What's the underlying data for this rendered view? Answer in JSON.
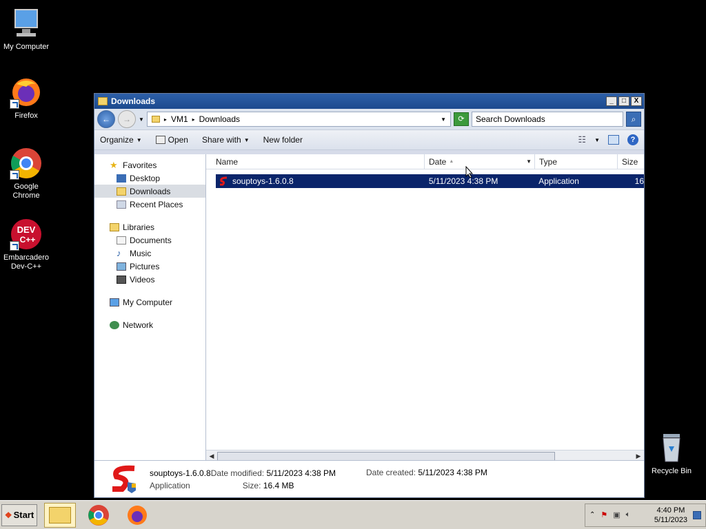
{
  "desktop": {
    "icons": [
      {
        "label": "My Computer"
      },
      {
        "label": "Firefox"
      },
      {
        "label": "Google Chrome"
      },
      {
        "label": "Embarcadero Dev-C++"
      },
      {
        "label": "Recycle Bin"
      }
    ]
  },
  "window": {
    "title": "Downloads",
    "buttons": {
      "minimize": "_",
      "maximize": "□",
      "close": "X"
    }
  },
  "addressbar": {
    "crumbs": [
      "VM1",
      "Downloads"
    ],
    "search_placeholder": "Search Downloads"
  },
  "toolbar": {
    "organize": "Organize",
    "open": "Open",
    "share_with": "Share with",
    "new_folder": "New folder"
  },
  "navpane": {
    "favorites": {
      "label": "Favorites",
      "items": [
        "Desktop",
        "Downloads",
        "Recent Places"
      ]
    },
    "libraries": {
      "label": "Libraries",
      "items": [
        "Documents",
        "Music",
        "Pictures",
        "Videos"
      ]
    },
    "computer": "My Computer",
    "network": "Network"
  },
  "columns": [
    "Name",
    "Date",
    "Type",
    "Size"
  ],
  "files": [
    {
      "name": "souptoys-1.6.0.8",
      "date": "5/11/2023 4:38 PM",
      "type": "Application",
      "size": "16"
    }
  ],
  "details": {
    "name": "souptoys-1.6.0.8",
    "type": "Application",
    "date_modified_label": "Date modified:",
    "date_modified": "5/11/2023 4:38 PM",
    "size_label": "Size:",
    "size": "16.4 MB",
    "date_created_label": "Date created:",
    "date_created": "5/11/2023 4:38 PM"
  },
  "taskbar": {
    "start": "Start",
    "time": "4:40 PM",
    "date": "5/11/2023"
  },
  "colors": {
    "selection": "#0a246a",
    "titlebar": "#1c4a8e"
  }
}
